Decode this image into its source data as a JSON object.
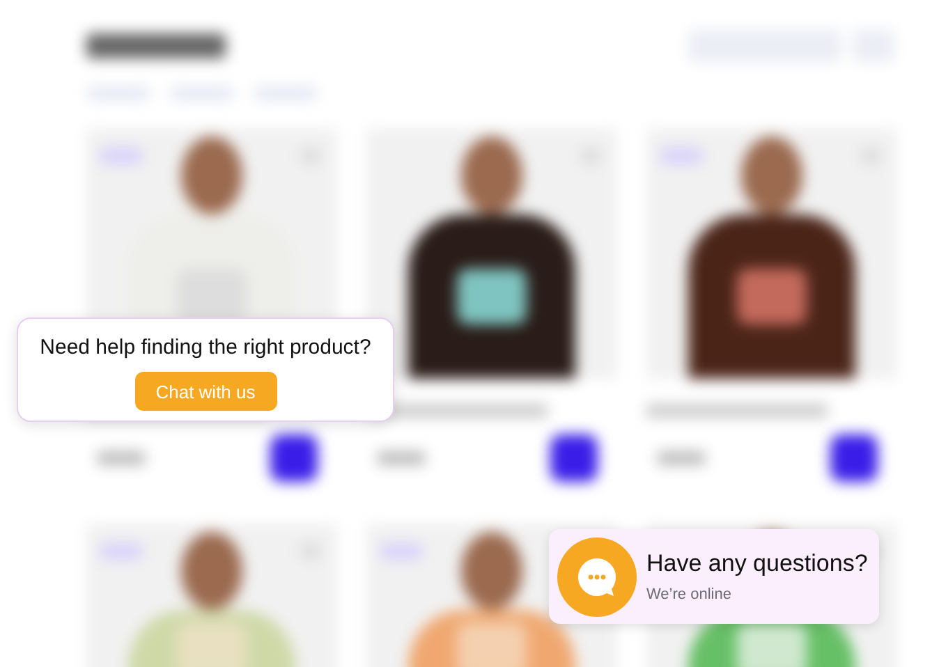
{
  "help_popup": {
    "message": "Need help finding the right product?",
    "button": "Chat with us"
  },
  "chat_widget": {
    "title": "Have any questions?",
    "status": "We’re online"
  }
}
